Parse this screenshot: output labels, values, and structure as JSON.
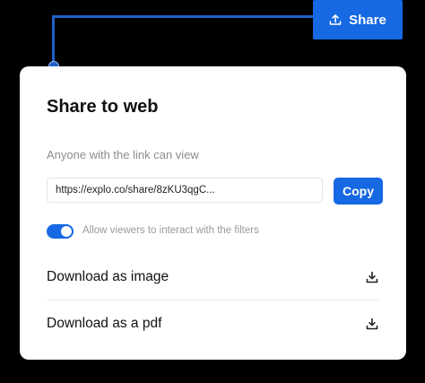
{
  "share_button": {
    "label": "Share",
    "icon": "upload-icon"
  },
  "dialog": {
    "title": "Share to web",
    "subtitle": "Anyone with the link can view",
    "link_value": "https://explo.co/share/8zKU3qgC...",
    "copy_label": "Copy",
    "toggle": {
      "label": "Allow viewers to interact with the filters",
      "on": true
    },
    "options": [
      {
        "label": "Download as image",
        "icon": "download-icon"
      },
      {
        "label": "Download as a pdf",
        "icon": "download-icon"
      }
    ]
  },
  "colors": {
    "accent": "#1668e3",
    "connector": "#1f5fc4",
    "background": "#000000",
    "card": "#ffffff"
  }
}
